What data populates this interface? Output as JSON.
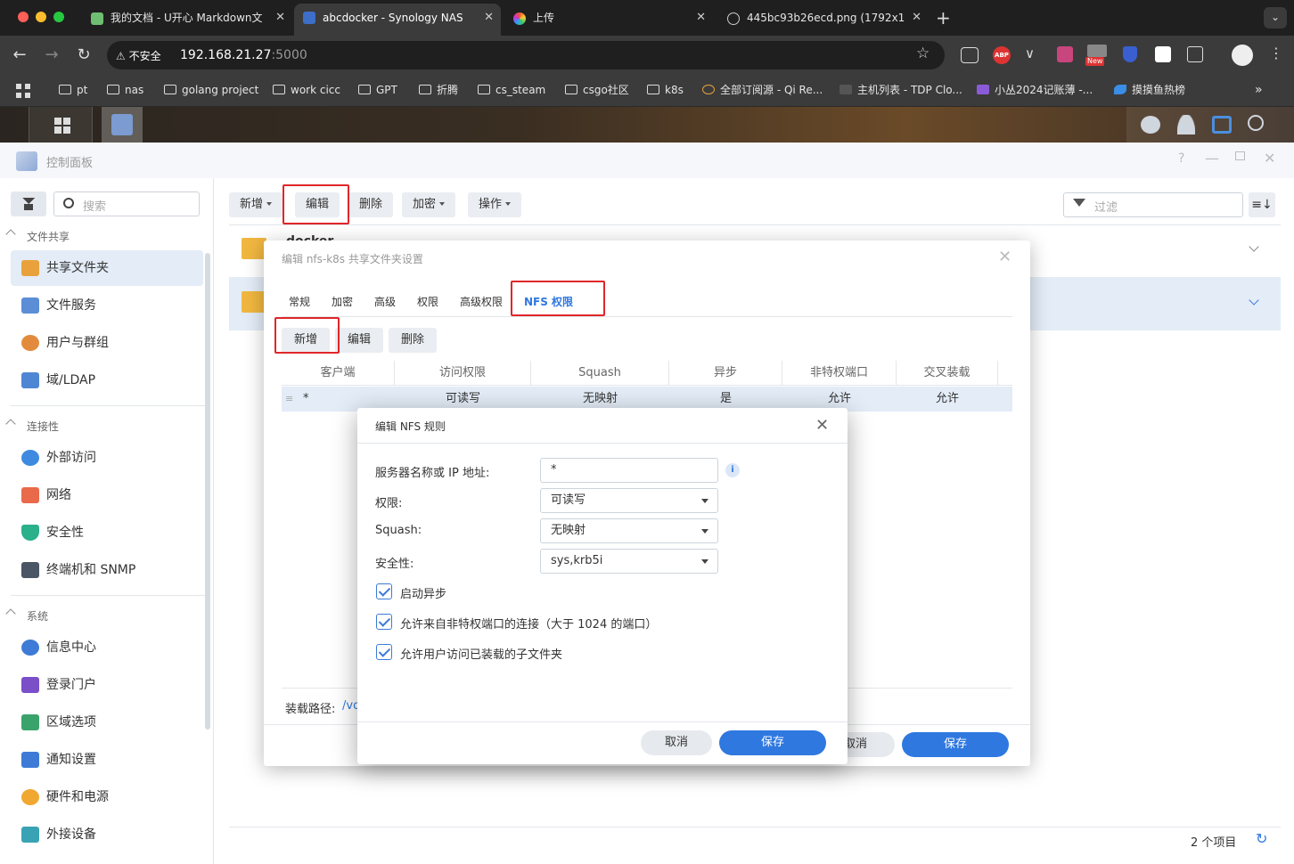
{
  "browser": {
    "tabs": [
      {
        "title": "我的文档 - U开心 Markdown文"
      },
      {
        "title": "abcdocker - Synology NAS"
      },
      {
        "title": "上传"
      },
      {
        "title": "445bc93b26ecd.png (1792x1"
      }
    ],
    "security_label": "不安全",
    "url_host": "192.168.21.27",
    "url_port": ":5000",
    "bookmarks": [
      "pt",
      "nas",
      "golang project",
      "work cicc",
      "GPT",
      "折腾",
      "cs_steam",
      "csgo社区",
      "k8s",
      "全部订阅源 - Qi Re...",
      "主机列表 - TDP Clo...",
      "小丛2024记账薄 -...",
      "摸摸鱼热榜"
    ],
    "ext_badge": "New",
    "abp": "ABP"
  },
  "panel": {
    "title": "控制面板",
    "search_placeholder": "搜索",
    "filter_placeholder": "过滤",
    "sections": [
      {
        "header": "文件共享",
        "items": [
          "共享文件夹",
          "文件服务",
          "用户与群组",
          "域/LDAP"
        ]
      },
      {
        "header": "连接性",
        "items": [
          "外部访问",
          "网络",
          "安全性",
          "终端机和 SNMP"
        ]
      },
      {
        "header": "系统",
        "items": [
          "信息中心",
          "登录门户",
          "区域选项",
          "通知设置",
          "硬件和电源",
          "外接设备"
        ]
      }
    ],
    "toolbar": {
      "create": "新增",
      "edit": "编辑",
      "delete": "删除",
      "encrypt": "加密",
      "action": "操作"
    },
    "folder1_name": "docker",
    "status_count": "2 个项目"
  },
  "share_dialog": {
    "title": "编辑 nfs-k8s 共享文件夹设置",
    "tabs": [
      "常规",
      "加密",
      "高级",
      "权限",
      "高级权限",
      "NFS 权限"
    ],
    "btn_create": "新增",
    "btn_edit": "编辑",
    "btn_delete": "删除",
    "columns": [
      "客户端",
      "访问权限",
      "Squash",
      "异步",
      "非特权端口",
      "交叉装载"
    ],
    "rows": [
      {
        "client": "*",
        "access": "可读写",
        "squash": "无映射",
        "async": "是",
        "nonpriv": "允许",
        "crossmnt": "允许"
      }
    ],
    "mount_label": "装载路径:",
    "mount_value": "/vo",
    "cancel": "取消",
    "save": "保存"
  },
  "nfs_dialog": {
    "title": "编辑 NFS 规则",
    "host_label": "服务器名称或 IP 地址:",
    "host_value": "*",
    "perm_label": "权限:",
    "perm_value": "可读写",
    "squash_label": "Squash:",
    "squash_value": "无映射",
    "sec_label": "安全性:",
    "sec_value": "sys,krb5i",
    "chk_async": "启动异步",
    "chk_nonpriv": "允许来自非特权端口的连接（大于 1024 的端口）",
    "chk_subdir": "允许用户访问已装载的子文件夹",
    "cancel": "取消",
    "save": "保存"
  },
  "colors": {
    "accent": "#2f78e0",
    "highlight": "#e0262a",
    "selected_row": "#e3ecf7"
  }
}
